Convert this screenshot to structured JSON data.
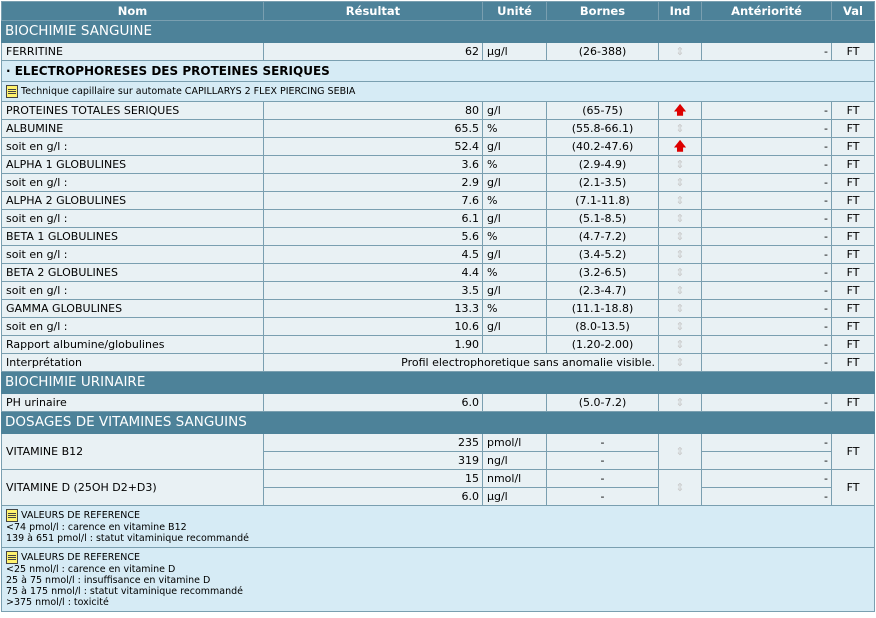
{
  "headers": {
    "nom": "Nom",
    "resultat": "Résultat",
    "unite": "Unité",
    "bornes": "Bornes",
    "ind": "Ind",
    "anteriorite": "Antériorité",
    "val": "Val"
  },
  "sections": {
    "biochimie_sanguine": "BIOCHIMIE SANGUINE",
    "biochimie_urinaire": "BIOCHIMIE URINAIRE",
    "vitamines": "DOSAGES DE VITAMINES SANGUINS"
  },
  "ferritine": {
    "nom": "FERRITINE",
    "resultat": "62",
    "unite": "µg/l",
    "bornes": "(26-388)",
    "ant": "-",
    "val": "FT"
  },
  "electro": {
    "title": "· ELECTROPHORESES DES PROTEINES SERIQUES",
    "note": "Technique capillaire sur automate CAPILLARYS 2 FLEX PIERCING SEBIA",
    "rows": [
      {
        "nom": "PROTEINES TOTALES SERIQUES",
        "resultat": "80",
        "unite": "g/l",
        "bornes": "(65-75)",
        "ant": "-",
        "val": "FT"
      },
      {
        "nom": "ALBUMINE",
        "resultat": "65.5",
        "unite": "%",
        "bornes": "(55.8-66.1)",
        "ant": "-",
        "val": "FT"
      },
      {
        "nom": " soit en g/l :",
        "resultat": "52.4",
        "unite": "g/l",
        "bornes": "(40.2-47.6)",
        "ant": "-",
        "val": "FT"
      },
      {
        "nom": "ALPHA 1 GLOBULINES",
        "resultat": "3.6",
        "unite": "%",
        "bornes": "(2.9-4.9)",
        "ant": "-",
        "val": "FT"
      },
      {
        "nom": " soit en g/l :",
        "resultat": "2.9",
        "unite": "g/l",
        "bornes": "(2.1-3.5)",
        "ant": "-",
        "val": "FT"
      },
      {
        "nom": "ALPHA 2 GLOBULINES",
        "resultat": "7.6",
        "unite": "%",
        "bornes": "(7.1-11.8)",
        "ant": "-",
        "val": "FT"
      },
      {
        "nom": " soit en g/l :",
        "resultat": "6.1",
        "unite": "g/l",
        "bornes": "(5.1-8.5)",
        "ant": "-",
        "val": "FT"
      },
      {
        "nom": "BETA 1 GLOBULINES",
        "resultat": "5.6",
        "unite": "%",
        "bornes": "(4.7-7.2)",
        "ant": "-",
        "val": "FT"
      },
      {
        "nom": " soit en g/l :",
        "resultat": "4.5",
        "unite": "g/l",
        "bornes": "(3.4-5.2)",
        "ant": "-",
        "val": "FT"
      },
      {
        "nom": " BETA 2 GLOBULINES",
        "resultat": "4.4",
        "unite": "%",
        "bornes": "(3.2-6.5)",
        "ant": "-",
        "val": "FT"
      },
      {
        "nom": " soit en g/l :",
        "resultat": "3.5",
        "unite": "g/l",
        "bornes": "(2.3-4.7)",
        "ant": "-",
        "val": "FT"
      },
      {
        "nom": "GAMMA GLOBULINES",
        "resultat": "13.3",
        "unite": "%",
        "bornes": "(11.1-18.8)",
        "ant": "-",
        "val": "FT"
      },
      {
        "nom": " soit en g/l :",
        "resultat": "10.6",
        "unite": "g/l",
        "bornes": "(8.0-13.5)",
        "ant": "-",
        "val": "FT"
      },
      {
        "nom": "Rapport albumine/globulines",
        "resultat": "1.90",
        "unite": "",
        "bornes": "(1.20-2.00)",
        "ant": "-",
        "val": "FT"
      }
    ],
    "interpretation": {
      "nom": "Interprétation",
      "resultat": "Profil electrophoretique sans anomalie visible.",
      "ant": "-",
      "val": "FT"
    }
  },
  "ph": {
    "nom": "PH urinaire",
    "resultat": "6.0",
    "unite": "",
    "bornes": "(5.0-7.2)",
    "ant": "-",
    "val": "FT"
  },
  "b12": {
    "nom": "VITAMINE B12",
    "r1": "235",
    "u1": "pmol/l",
    "b1": "-",
    "a1": "-",
    "r2": "319",
    "u2": "ng/l",
    "b2": "-",
    "a2": "-",
    "val": "FT"
  },
  "vitd": {
    "nom": "VITAMINE D (25OH D2+D3)",
    "r1": "15",
    "u1": "nmol/l",
    "b1": "-",
    "a1": "-",
    "r2": "6.0",
    "u2": "µg/l",
    "b2": "-",
    "a2": "-",
    "val": "FT"
  },
  "ref_b12": [
    "VALEURS DE REFERENCE",
    "<74 pmol/l : carence en vitamine B12",
    "139 à 651 pmol/l : statut vitaminique recommandé"
  ],
  "ref_vitd": [
    "VALEURS DE REFERENCE",
    "<25 nmol/l : carence en vitamine D",
    "25 à 75 nmol/l : insuffisance en vitamine D",
    "75 à 175 nmol/l : statut vitaminique recommandé",
    ">375 nmol/l : toxicité"
  ],
  "icons": {
    "arrow_up": "red-up-arrow-icon",
    "updown": "grey-up-down-arrow-icon",
    "note": "note-icon"
  }
}
